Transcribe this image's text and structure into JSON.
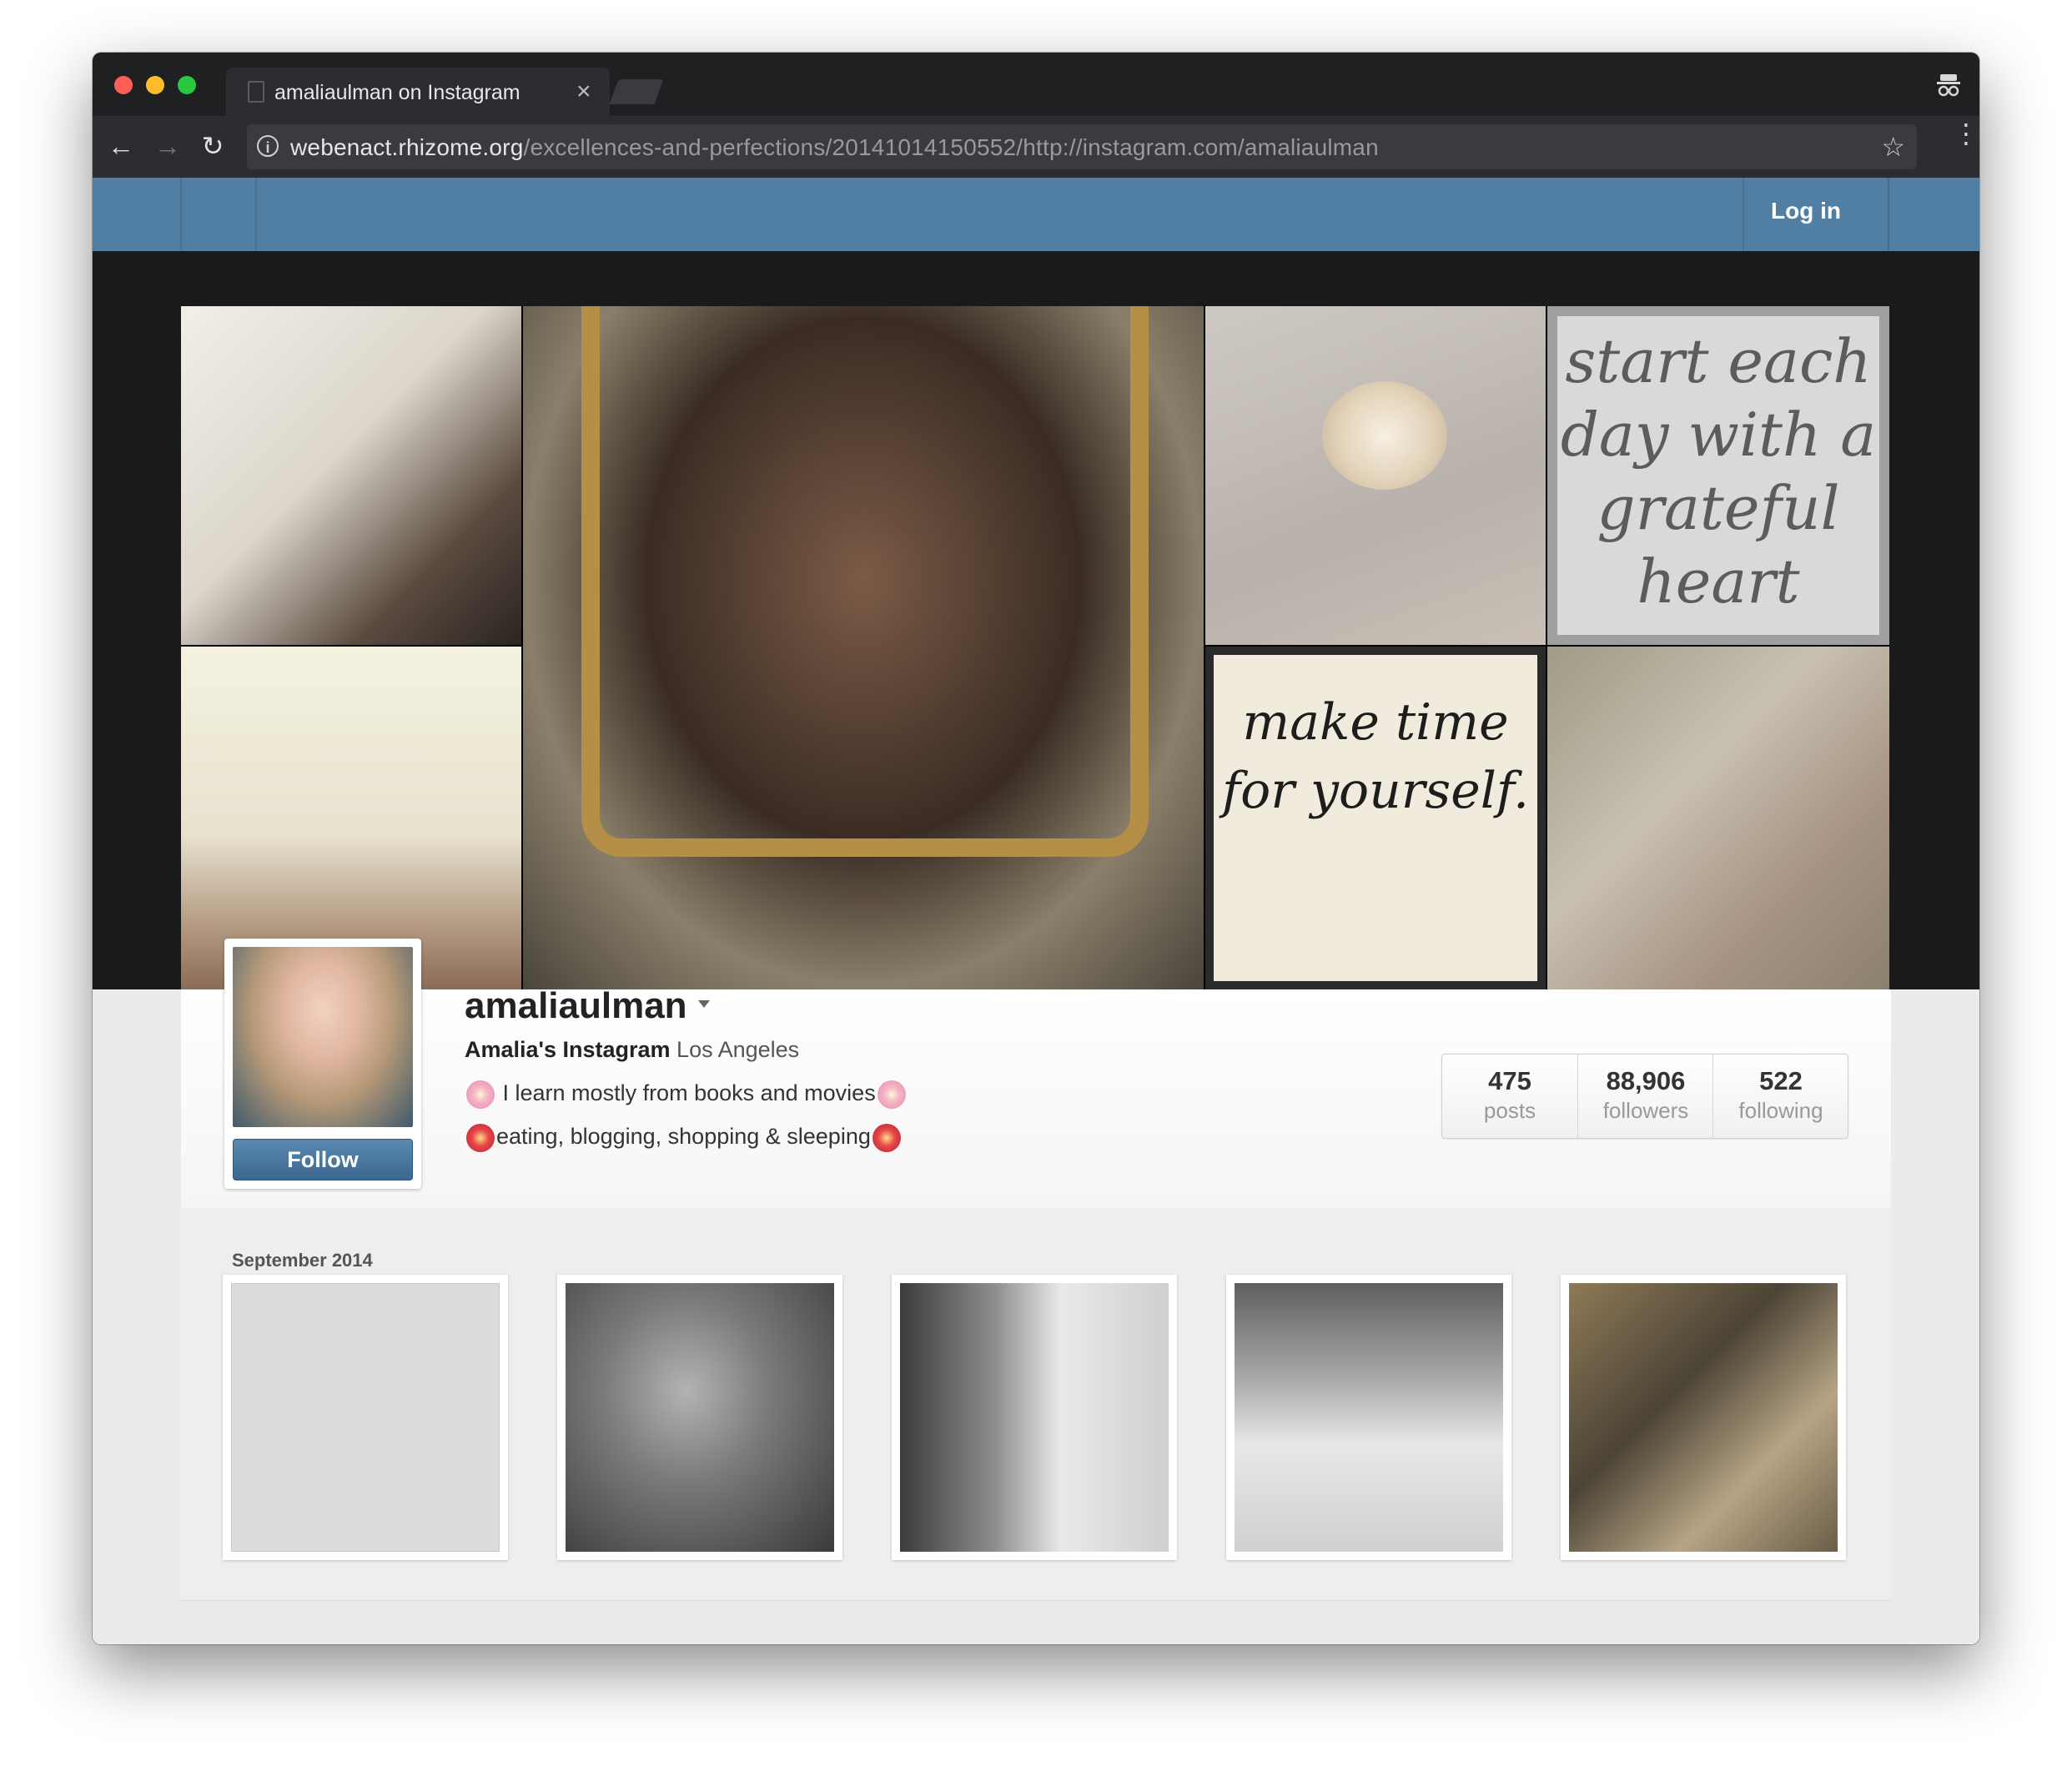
{
  "browser": {
    "tab_title": "amaliaulman on Instagram",
    "url_host": "webenact.rhizome.org",
    "url_path": "/excellences-and-perfections/20141014150552/http://instagram.com/amaliaulman",
    "icons": [
      "back-arrow-icon",
      "forward-arrow-icon",
      "reload-icon",
      "info-icon",
      "star-icon",
      "menu-icon",
      "incognito-icon",
      "close-icon"
    ]
  },
  "header": {
    "login_label": "Log in",
    "color": "#517fa4"
  },
  "hero": {
    "quote1": "start each day with a grateful heart",
    "quote2": "make time for yourself."
  },
  "profile": {
    "username": "amaliaulman",
    "full_name": "Amalia's Instagram",
    "location": "Los Angeles",
    "bio_line1": "I learn mostly from books and movies",
    "bio_line2": "eating, blogging, shopping & sleeping",
    "follow_label": "Follow",
    "stats": [
      {
        "count": "475",
        "label": "posts"
      },
      {
        "count": "88,906",
        "label": "followers"
      },
      {
        "count": "522",
        "label": "following"
      }
    ]
  },
  "feed": {
    "month": "September 2014"
  }
}
